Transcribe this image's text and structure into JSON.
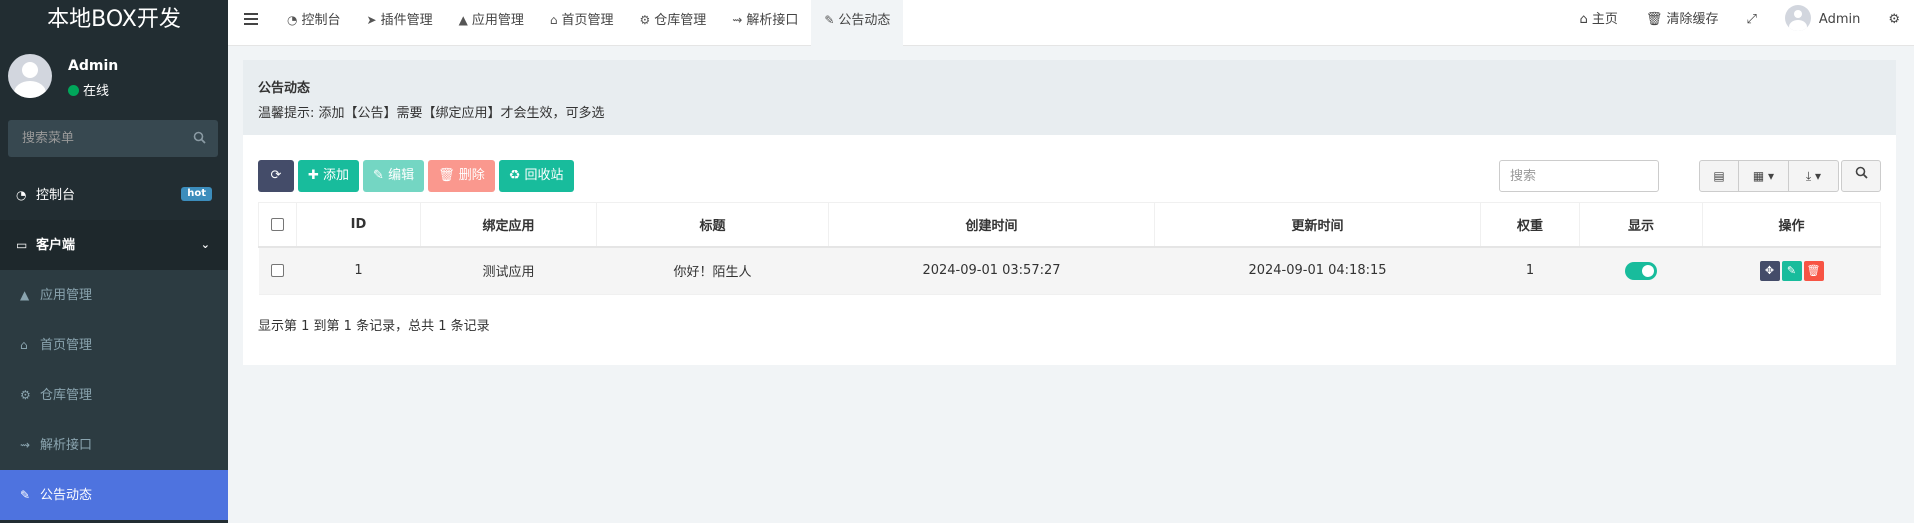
{
  "app": {
    "logo": "本地BOX开发"
  },
  "user": {
    "name": "Admin",
    "status": "在线"
  },
  "sidebar": {
    "search_placeholder": "搜索菜单",
    "items": [
      {
        "label": "控制台",
        "icon": "dashboard-icon",
        "badge": "hot"
      },
      {
        "label": "客户端",
        "icon": "inbox-icon"
      },
      {
        "label": "应用管理",
        "icon": "android-icon"
      },
      {
        "label": "首页管理",
        "icon": "home-icon"
      },
      {
        "label": "仓库管理",
        "icon": "cogs-icon"
      },
      {
        "label": "解析接口",
        "icon": "usb-icon"
      },
      {
        "label": "公告动态",
        "icon": "bullhorn-icon"
      }
    ]
  },
  "navbar": {
    "tabs": [
      {
        "label": "控制台",
        "icon": "dashboard-icon"
      },
      {
        "label": "插件管理",
        "icon": "rocket-icon"
      },
      {
        "label": "应用管理",
        "icon": "android-icon"
      },
      {
        "label": "首页管理",
        "icon": "home-icon"
      },
      {
        "label": "仓库管理",
        "icon": "cogs-icon"
      },
      {
        "label": "解析接口",
        "icon": "usb-icon"
      },
      {
        "label": "公告动态",
        "icon": "bullhorn-icon"
      }
    ],
    "right": {
      "home": "主页",
      "clear_cache": "清除缓存",
      "user": "Admin"
    }
  },
  "panel": {
    "title": "公告动态",
    "tip": "温馨提示: 添加【公告】需要【绑定应用】才会生效，可多选"
  },
  "toolbar": {
    "add": "添加",
    "edit": "编辑",
    "delete": "删除",
    "recycle": "回收站",
    "search_placeholder": "搜索"
  },
  "table": {
    "headers": [
      "ID",
      "绑定应用",
      "标题",
      "创建时间",
      "更新时间",
      "权重",
      "显示",
      "操作"
    ],
    "rows": [
      {
        "id": "1",
        "app": "测试应用",
        "title": "你好！陌生人",
        "created": "2024-09-01 03:57:27",
        "updated": "2024-09-01 04:18:15",
        "weight": "1",
        "show": true
      }
    ]
  },
  "footer": {
    "info": "显示第 1 到第 1 条记录，总共 1 条记录"
  },
  "colors": {
    "sidebar_bg": "#222d32",
    "active": "#4e73df",
    "success": "#18bc9c",
    "danger": "#f75444",
    "dark": "#444c69"
  }
}
